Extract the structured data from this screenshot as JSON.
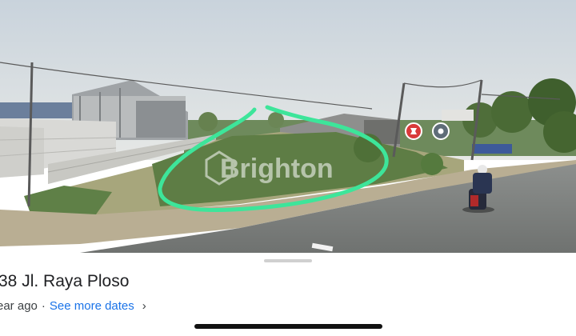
{
  "location": {
    "title": "38 Jl. Raya Ploso",
    "date_text": "ear ago",
    "separator": "·",
    "see_more_label": "See more dates",
    "chevron_glyph": "›"
  },
  "watermark": {
    "text": "Brighton"
  },
  "colors": {
    "annotation": "#3de59a",
    "link": "#1a73e8"
  },
  "icons": {
    "marker_left": "location-marker-icon",
    "marker_right": "location-marker-icon"
  }
}
